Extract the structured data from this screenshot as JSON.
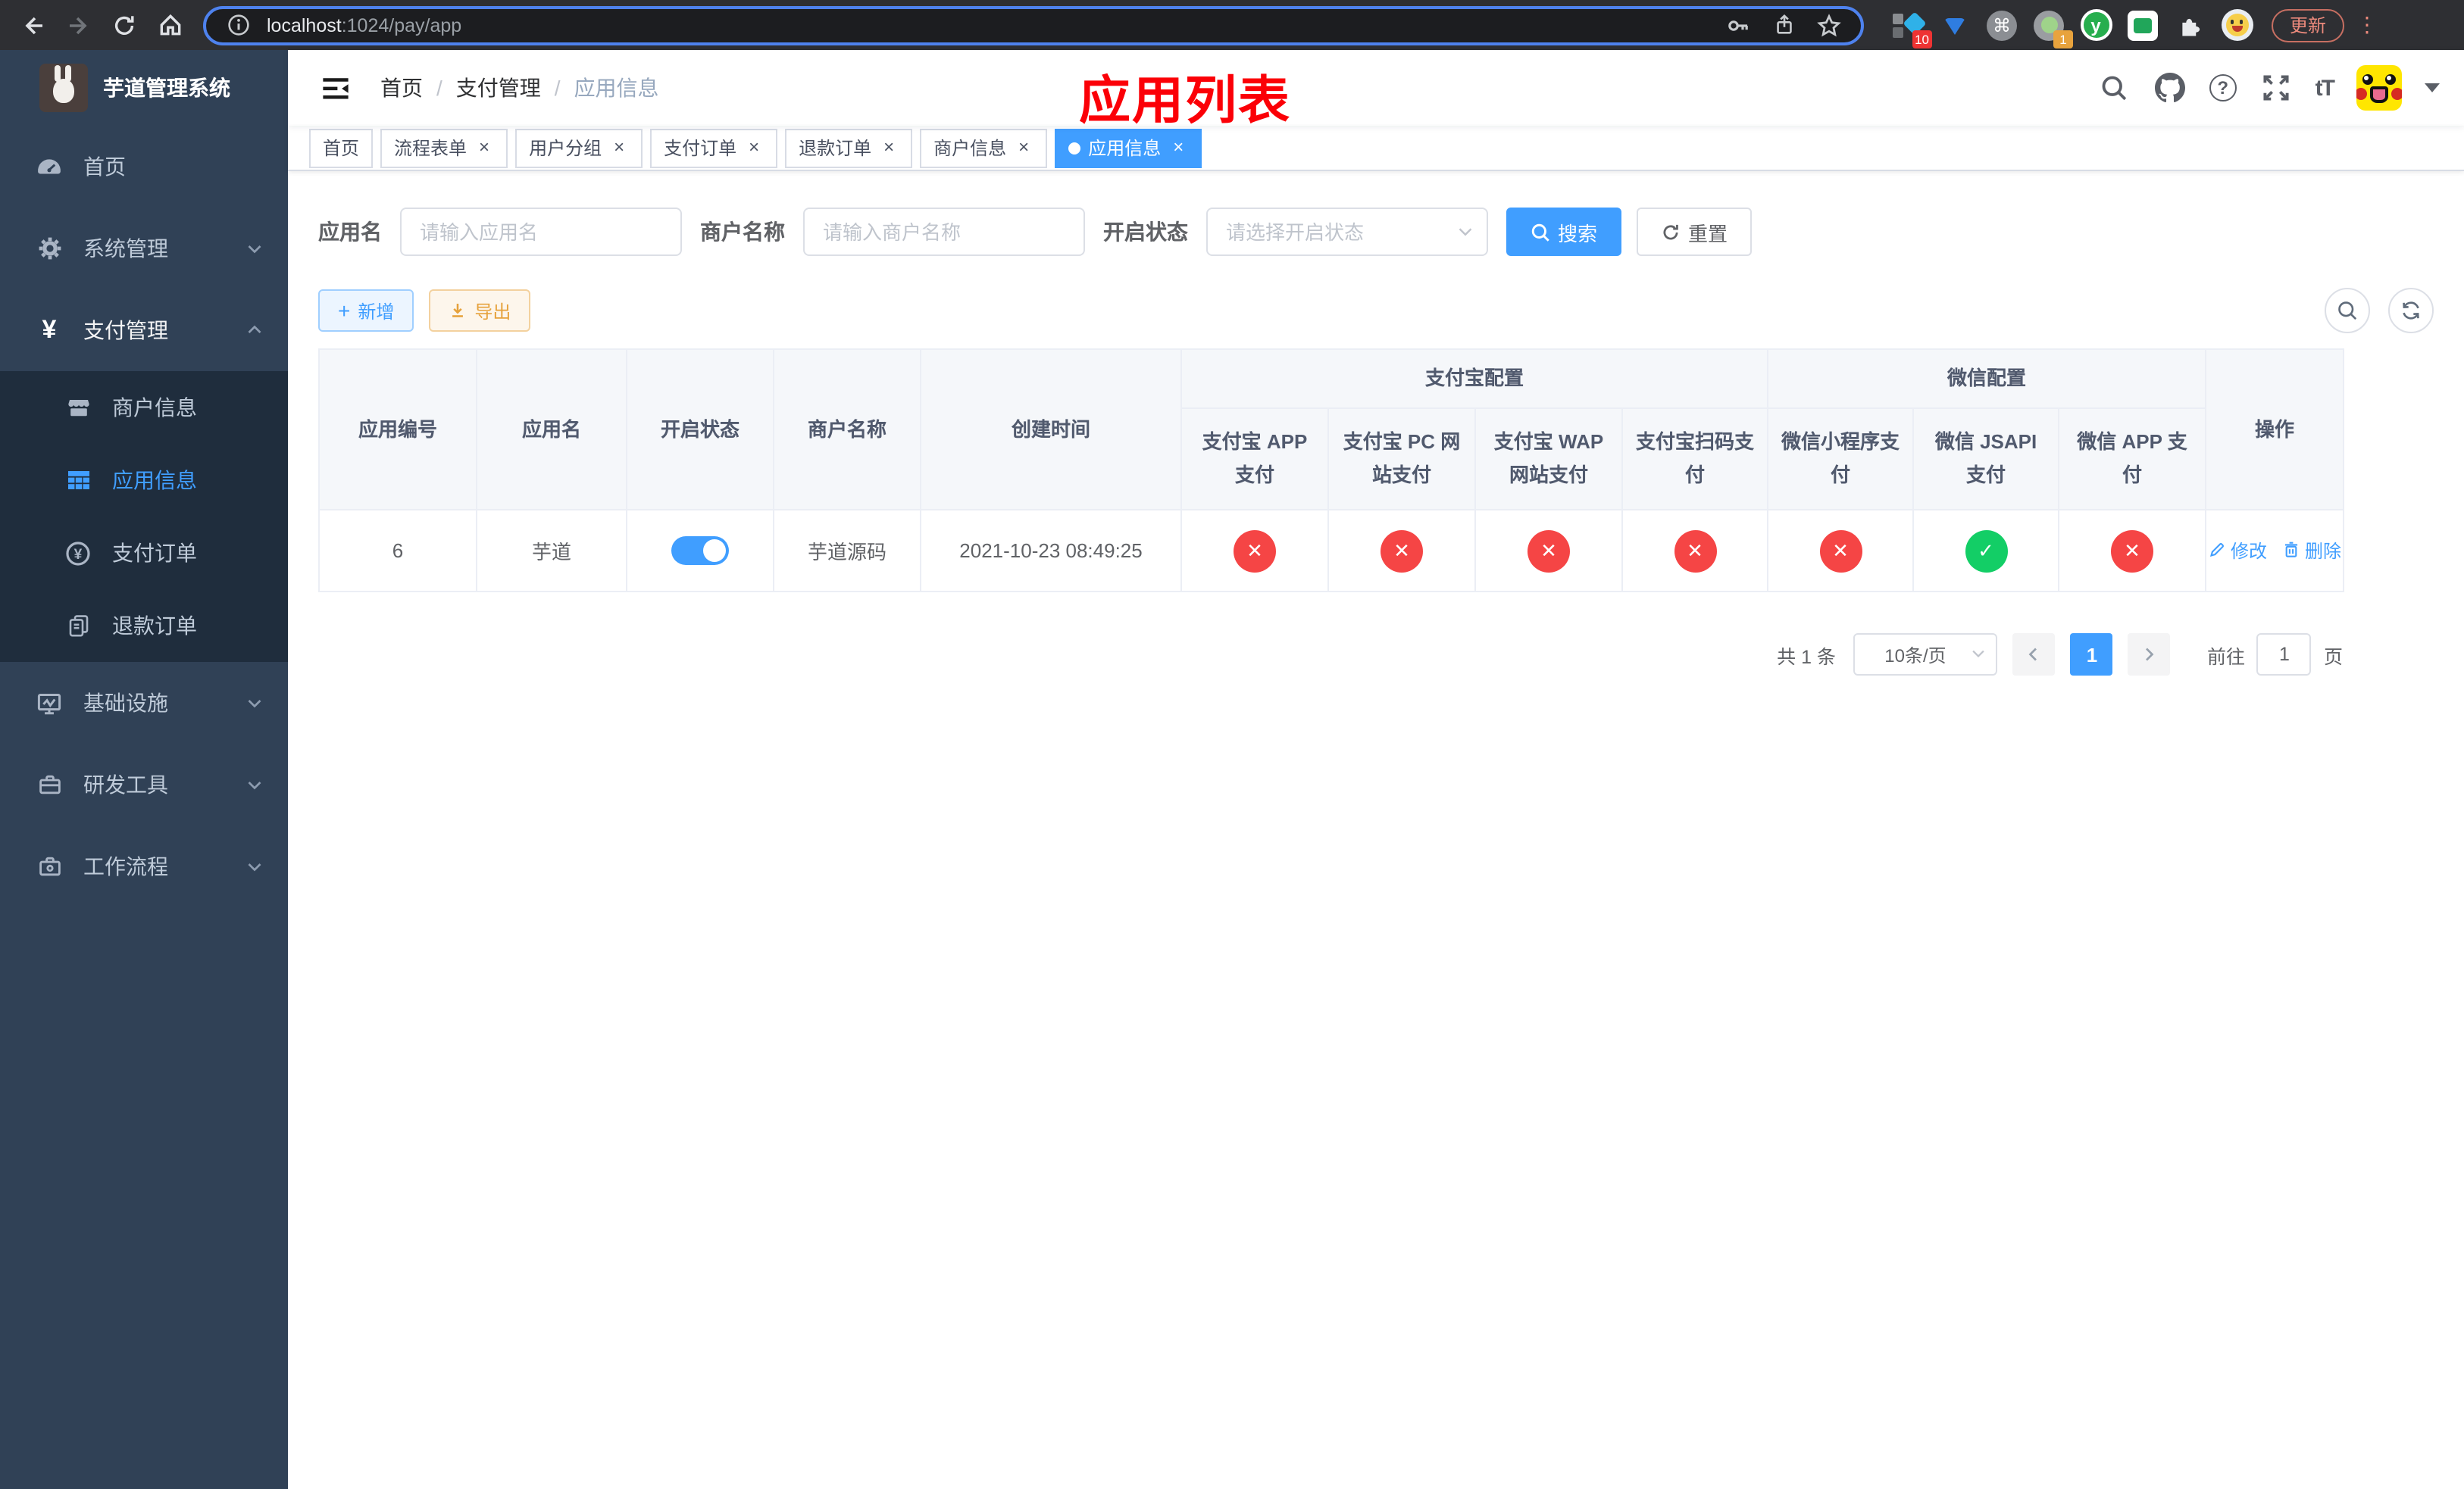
{
  "colors": {
    "accent": "#409eff",
    "success": "#13ce66",
    "danger": "#f54545",
    "warning": "#e6a23c",
    "annotation_red": "#fb0007",
    "sidebar_bg": "#304156",
    "submenu_bg": "#1f2d3d"
  },
  "icons": {
    "yen": "¥",
    "command": "⌘",
    "question": "?",
    "text_size": "tT",
    "y_ext": "y",
    "plus": "+",
    "close": "×",
    "check": "✓",
    "cross": "✕",
    "dots": "⋮"
  },
  "browser": {
    "url_host": "localhost",
    "url_rest": ":1024/pay/app",
    "update_button": "更新",
    "ext_badge_1": "10",
    "ext_badge_2": "1"
  },
  "sidebar": {
    "title": "芋道管理系统",
    "home": "首页",
    "system": "系统管理",
    "pay": "支付管理",
    "merchant": "商户信息",
    "app": "应用信息",
    "order": "支付订单",
    "refund": "退款订单",
    "infra": "基础设施",
    "dev": "研发工具",
    "flow": "工作流程"
  },
  "header": {
    "breadcrumb_home": "首页",
    "breadcrumb_pay": "支付管理",
    "breadcrumb_app": "应用信息",
    "separator": "/",
    "annotation": "应用列表"
  },
  "tabs": {
    "t0": "首页",
    "t1": "流程表单",
    "t2": "用户分组",
    "t3": "支付订单",
    "t4": "退款订单",
    "t5": "商户信息",
    "t6": "应用信息"
  },
  "filters": {
    "app_name_label": "应用名",
    "app_name_placeholder": "请输入应用名",
    "merchant_label": "商户名称",
    "merchant_placeholder": "请输入商户名称",
    "status_label": "开启状态",
    "status_placeholder": "请选择开启状态",
    "search_button": "搜索",
    "reset_button": "重置"
  },
  "toolbar": {
    "add_button": "新增",
    "export_button": "导出"
  },
  "table": {
    "col_id": "应用编号",
    "col_name": "应用名",
    "col_status": "开启状态",
    "col_merchant": "商户名称",
    "col_created": "创建时间",
    "group_alipay": "支付宝配置",
    "group_wechat": "微信配置",
    "col_alipay_app": "支付宝 APP 支付",
    "col_alipay_pc": "支付宝 PC 网站支付",
    "col_alipay_wap": "支付宝 WAP 网站支付",
    "col_alipay_qr": "支付宝扫码支付",
    "col_wx_mini": "微信小程序支付",
    "col_wx_jsapi": "微信 JSAPI 支付",
    "col_wx_app": "微信 APP 支付",
    "col_action": "操作",
    "row": {
      "id": "6",
      "name": "芋道",
      "enabled": true,
      "merchant": "芋道源码",
      "created": "2021-10-23 08:49:25",
      "statuses": [
        "cross",
        "cross",
        "cross",
        "cross",
        "cross",
        "check",
        "cross"
      ],
      "edit": "修改",
      "delete": "删除"
    }
  },
  "pagination": {
    "total": "共 1 条",
    "page_size": "10条/页",
    "current_page": "1",
    "goto_label": "前往",
    "goto_value": "1",
    "page_unit": "页"
  }
}
